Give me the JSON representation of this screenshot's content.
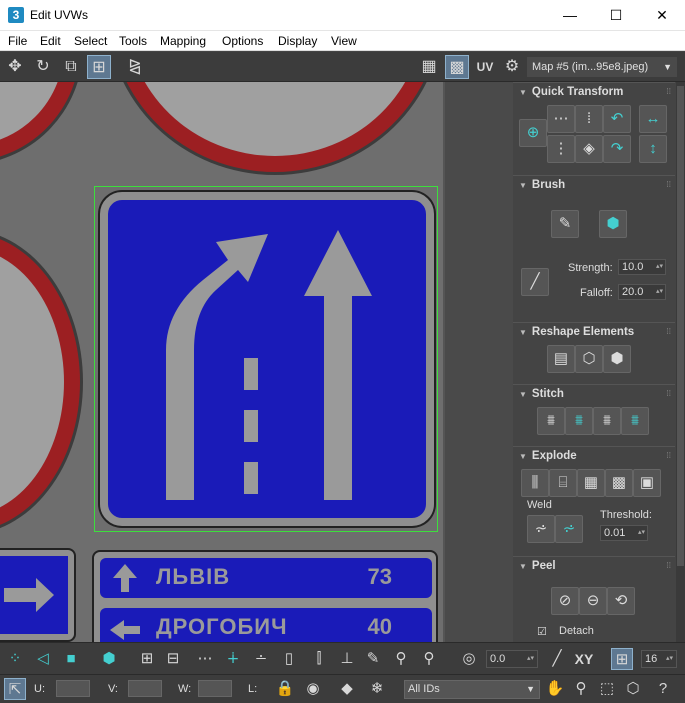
{
  "window": {
    "app_icon": "3",
    "title": "Edit UVWs",
    "minimize": "—",
    "maximize": "☐",
    "close": "✕"
  },
  "menu": [
    "File",
    "Edit",
    "Select",
    "Tools",
    "Mapping",
    "Options",
    "Display",
    "View"
  ],
  "toolbar": {
    "uv_label": "UV",
    "map_dropdown": "Map #5 (im...95e8.jpeg)"
  },
  "viewport": {
    "sign_rows": [
      {
        "label": "ЛЬВІВ",
        "value": "73"
      },
      {
        "label": "ДРОГОБИЧ",
        "value": "40"
      }
    ]
  },
  "panel": {
    "quick_transform": "Quick Transform",
    "brush": "Brush",
    "strength_label": "Strength:",
    "strength_value": "10.0",
    "falloff_label": "Falloff:",
    "falloff_value": "20.0",
    "reshape_elements": "Reshape Elements",
    "stitch": "Stitch",
    "explode": "Explode",
    "weld": "Weld",
    "threshold_label": "Threshold:",
    "threshold_value": "0.01",
    "peel": "Peel",
    "detach_label": "Detach",
    "detach_checked": true
  },
  "bottom": {
    "angle_value": "0.0",
    "xy_label": "XY",
    "grid_value": "16",
    "u_label": "U:",
    "v_label": "V:",
    "w_label": "W:",
    "l_label": "L:",
    "ids_select": "All IDs"
  },
  "colors": {
    "accent_teal": "#44cfd0",
    "sign_blue": "#1a1bb8",
    "sign_red": "#9c1f22",
    "selection_green": "#3ddf3d"
  }
}
